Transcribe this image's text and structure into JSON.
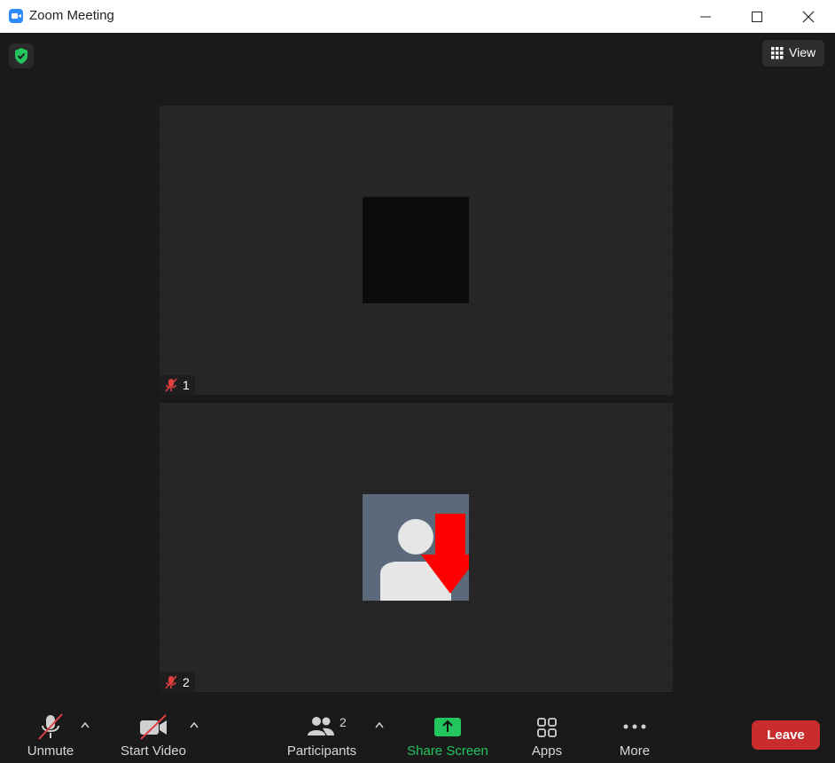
{
  "window": {
    "title": "Zoom Meeting"
  },
  "top": {
    "view_label": "View"
  },
  "participants": [
    {
      "number": "1",
      "muted": true
    },
    {
      "number": "2",
      "muted": true
    }
  ],
  "toolbar": {
    "unmute_label": "Unmute",
    "start_video_label": "Start Video",
    "participants_label": "Participants",
    "participants_count": "2",
    "share_label": "Share Screen",
    "apps_label": "Apps",
    "more_label": "More",
    "leave_label": "Leave"
  },
  "colors": {
    "accent_green": "#22c55e",
    "leave_red": "#c82c2c",
    "zoom_blue": "#2d8cff",
    "muted_red": "#e04040"
  }
}
